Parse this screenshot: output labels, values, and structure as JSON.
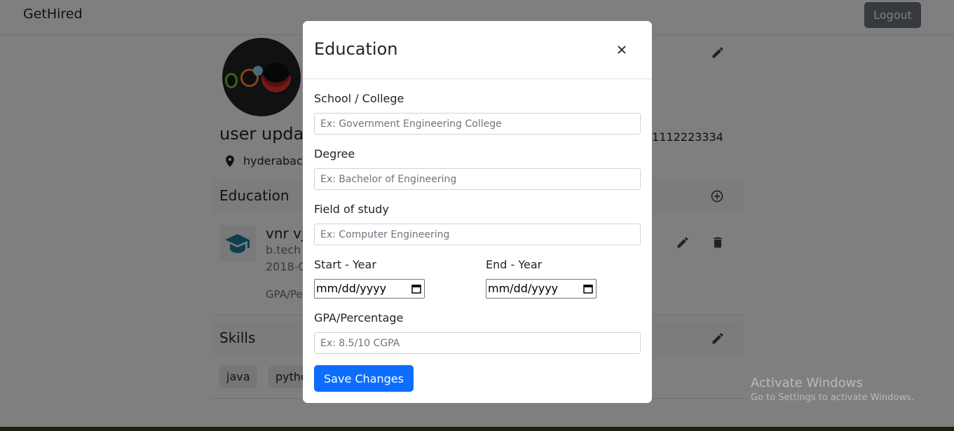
{
  "navbar": {
    "brand": "GetHired",
    "logout_label": "Logout"
  },
  "profile": {
    "name": "user upda",
    "phone": ", 1112223334",
    "location": "hyderabac"
  },
  "education_section": {
    "title": "Education",
    "entry": {
      "school": "vnr vj",
      "degree": "b.tech",
      "dates": "2018-0",
      "gpa": "GPA/Pe"
    }
  },
  "skills_section": {
    "title": "Skills",
    "skills": [
      "java",
      "pytho"
    ]
  },
  "modal": {
    "title": "Education",
    "school_label": "School / College",
    "school_placeholder": "Ex: Government Engineering College",
    "degree_label": "Degree",
    "degree_placeholder": "Ex: Bachelor of Engineering",
    "field_label": "Field of study",
    "field_placeholder": "Ex: Computer Engineering",
    "start_label": "Start - Year",
    "start_value": "mm/dd/yyyy",
    "end_label": "End - Year",
    "end_value": "mm/dd/yyyy",
    "gpa_label": "GPA/Percentage",
    "gpa_placeholder": "Ex: 8.5/10 CGPA",
    "save_label": "Save Changes"
  },
  "watermark": {
    "title": "Activate Windows",
    "subtitle": "Go to Settings to activate Windows."
  },
  "colors": {
    "primary": "#0d6efd",
    "secondary": "#6c757d",
    "accent_icon": "#1a7f9c"
  }
}
